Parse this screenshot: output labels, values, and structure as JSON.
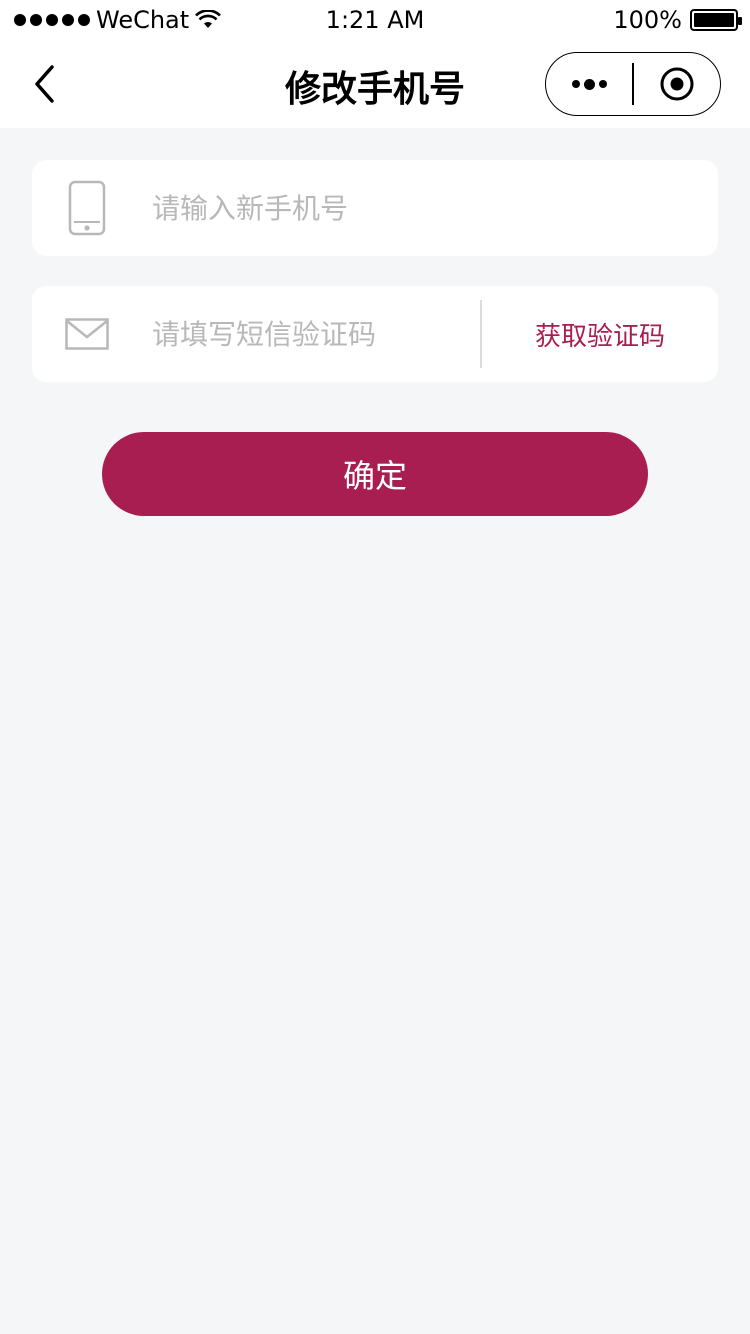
{
  "status_bar": {
    "carrier": "WeChat",
    "time": "1:21 AM",
    "battery": "100%"
  },
  "nav": {
    "title": "修改手机号",
    "icons": {
      "back": "chevron-left-icon",
      "more": "more-dots-icon",
      "close": "target-circle-icon"
    }
  },
  "form": {
    "phone": {
      "placeholder": "请输入新手机号",
      "value": "",
      "icon": "mobile-phone-icon"
    },
    "code": {
      "placeholder": "请填写短信验证码",
      "value": "",
      "icon": "envelope-icon"
    },
    "get_code_label": "获取验证码",
    "confirm_label": "确定"
  },
  "colors": {
    "accent": "#a91e50",
    "background": "#f5f6f8",
    "placeholder": "#b8b8b8"
  }
}
